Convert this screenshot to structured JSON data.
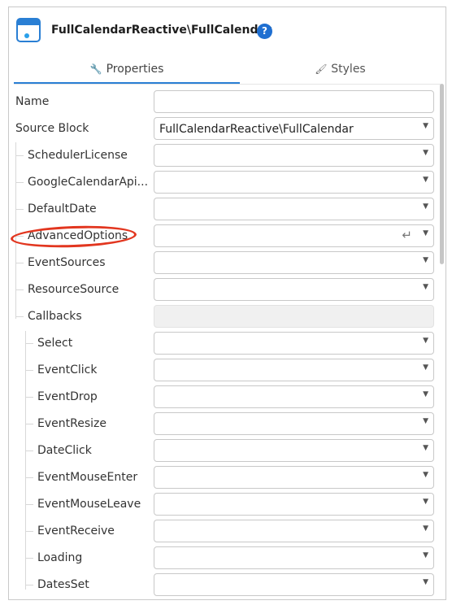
{
  "header": {
    "title": "FullCalendarReactive\\FullCalendar",
    "help": "?"
  },
  "tabs": [
    {
      "label": "Properties",
      "icon": "wrench-icon"
    },
    {
      "label": "Styles",
      "icon": "brush-icon"
    }
  ],
  "rows": [
    {
      "label": "Name",
      "value": "",
      "kind": "text"
    },
    {
      "label": "Source Block",
      "value": "FullCalendarReactive\\FullCalendar",
      "kind": "select"
    },
    {
      "label": "SchedulerLicense",
      "value": "",
      "kind": "select"
    },
    {
      "label": "GoogleCalendarApi...",
      "value": "",
      "kind": "select"
    },
    {
      "label": "DefaultDate",
      "value": "",
      "kind": "select"
    },
    {
      "label": "AdvancedOptions",
      "value": "",
      "kind": "text-enter"
    },
    {
      "label": "EventSources",
      "value": "",
      "kind": "select"
    },
    {
      "label": "ResourceSource",
      "value": "",
      "kind": "select"
    },
    {
      "label": "Callbacks",
      "value": "",
      "kind": "disabled"
    },
    {
      "label": "Select",
      "value": "",
      "kind": "select"
    },
    {
      "label": "EventClick",
      "value": "",
      "kind": "select"
    },
    {
      "label": "EventDrop",
      "value": "",
      "kind": "select"
    },
    {
      "label": "EventResize",
      "value": "",
      "kind": "select"
    },
    {
      "label": "DateClick",
      "value": "",
      "kind": "select"
    },
    {
      "label": "EventMouseEnter",
      "value": "",
      "kind": "select"
    },
    {
      "label": "EventMouseLeave",
      "value": "",
      "kind": "select"
    },
    {
      "label": "EventReceive",
      "value": "",
      "kind": "select"
    },
    {
      "label": "Loading",
      "value": "",
      "kind": "select"
    },
    {
      "label": "DatesSet",
      "value": "",
      "kind": "select"
    }
  ],
  "colors": {
    "accent": "#2a7fd4",
    "highlight": "#e2361f"
  }
}
